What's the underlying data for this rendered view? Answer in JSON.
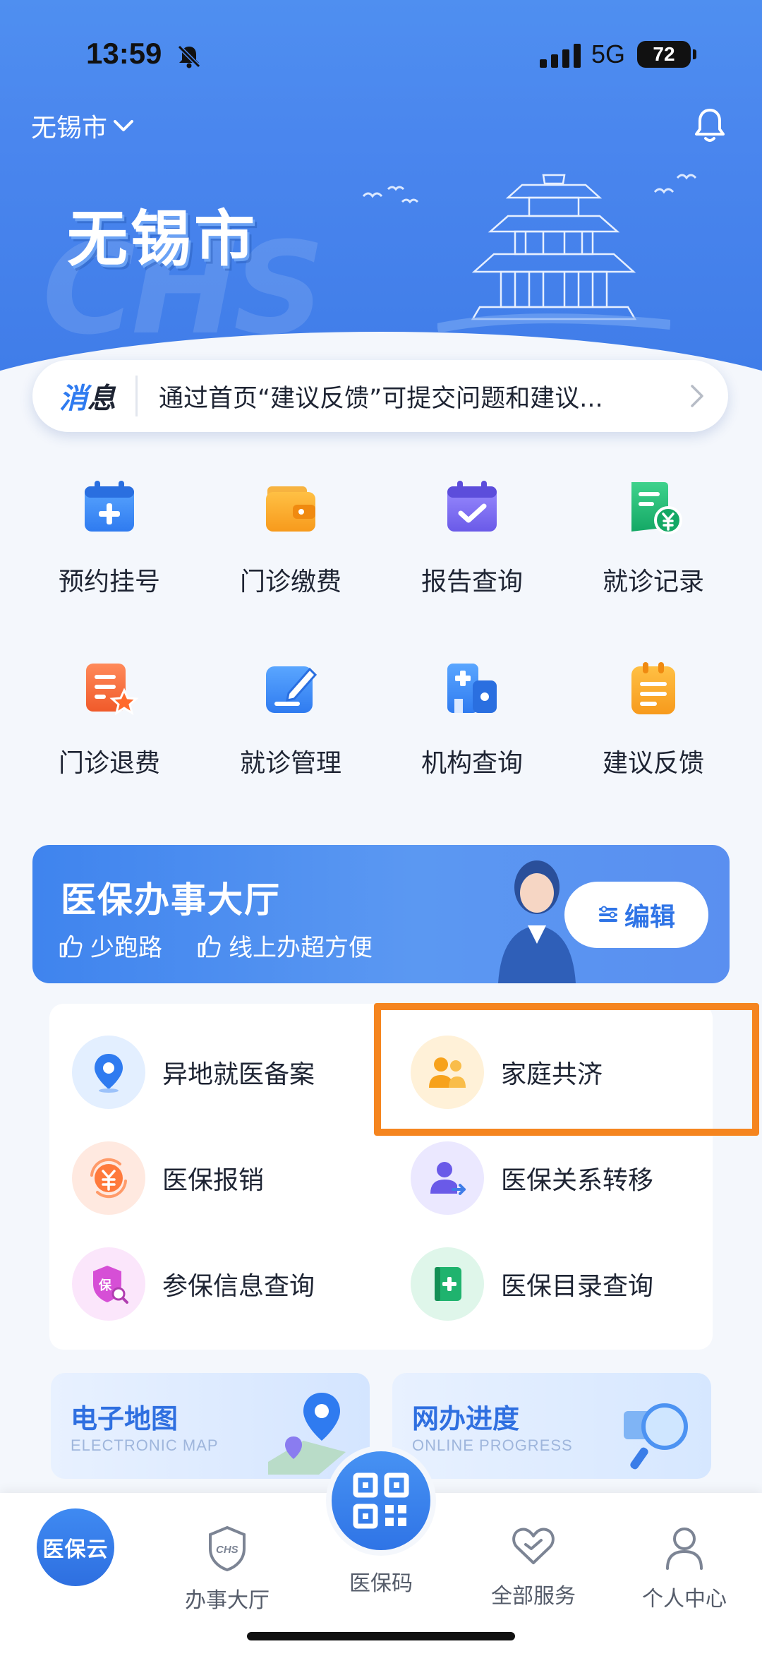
{
  "status_bar": {
    "time": "13:59",
    "network": "5G",
    "battery": "72"
  },
  "header": {
    "city": "无锡市"
  },
  "hero": {
    "title": "无锡市",
    "watermark": "CHS"
  },
  "message": {
    "tag_first": "消",
    "tag_rest": "息",
    "text": "通过首页“建议反馈”可提交问题和建议..."
  },
  "quick_services": [
    {
      "label": "预约挂号",
      "icon": "calendar-plus-icon"
    },
    {
      "label": "门诊缴费",
      "icon": "wallet-icon"
    },
    {
      "label": "报告查询",
      "icon": "calendar-check-icon"
    },
    {
      "label": "就诊记录",
      "icon": "receipt-yen-icon"
    },
    {
      "label": "门诊退费",
      "icon": "refund-star-icon"
    },
    {
      "label": "就诊管理",
      "icon": "edit-pen-icon"
    },
    {
      "label": "机构查询",
      "icon": "hospital-building-icon"
    },
    {
      "label": "建议反馈",
      "icon": "clipboard-feedback-icon"
    }
  ],
  "hall": {
    "title": "医保办事大厅",
    "tag1": "少跑路",
    "tag2": "线上办超方便",
    "edit_label": "编辑",
    "items": [
      {
        "label": "异地就医备案",
        "icon": "location-pin-icon"
      },
      {
        "label": "家庭共济",
        "icon": "family-users-icon"
      },
      {
        "label": "医保报销",
        "icon": "yen-refresh-icon"
      },
      {
        "label": "医保关系转移",
        "icon": "user-transfer-icon"
      },
      {
        "label": "参保信息查询",
        "icon": "insurance-shield-search-icon"
      },
      {
        "label": "医保目录查询",
        "icon": "catalog-book-icon"
      }
    ]
  },
  "promos": [
    {
      "title": "电子地图",
      "subtitle": "ELECTRONIC MAP"
    },
    {
      "title": "网办进度",
      "subtitle": "ONLINE PROGRESS"
    }
  ],
  "bottom_nav": {
    "home": "医保云",
    "hall": "办事大厅",
    "qr": "医保码",
    "services": "全部服务",
    "profile": "个人中心"
  },
  "colors": {
    "primary": "#3f84ee",
    "highlight": "#f5851f"
  }
}
